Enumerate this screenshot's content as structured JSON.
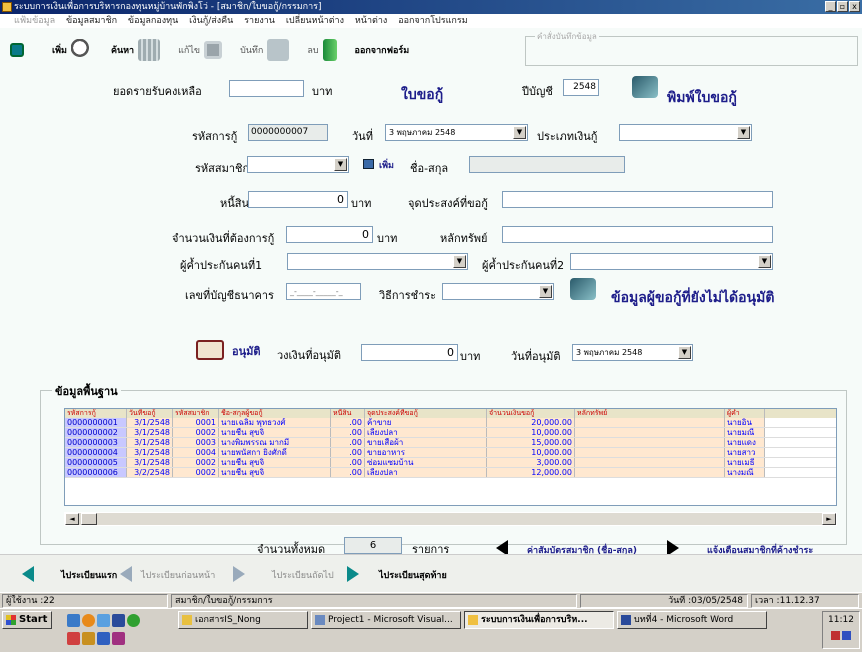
{
  "window": {
    "title": "ระบบการเงินเพื่อการบริหารกองทุนหมู่บ้านพักพิงโว่ - [สมาชิก/ใบขอกู้/กรรมการ]",
    "min": "_",
    "restore": "▫",
    "close": "x"
  },
  "menu": [
    "แฟ้มข้อมูล",
    "ข้อมูลสมาชิก",
    "ข้อมูลกองทุน",
    "เงินกู้/ส่งคืน",
    "รายงาน",
    "เปลี่ยนหน้าต่าง",
    "หน้าต่าง",
    "ออกจากโปรแกรม"
  ],
  "toolbar": {
    "add": "เพิ่ม",
    "search": "ค้นหา",
    "edit": "แก้ไข",
    "save": "บันทึก",
    "delete": "ลบ",
    "exit": "ออกจากฟอร์ม",
    "frame_label": "คำสั่งบันทึกข้อมูล"
  },
  "form": {
    "balance_label": "ยอดรายรับคงเหลือ",
    "balance_value": "",
    "baht": "บาท",
    "loan_slip_title": "ใบขอกู้",
    "fiscal_year_label": "ปีบัญชี",
    "fiscal_year": "2548",
    "print_label": "พิมพ์ใบขอกู้",
    "loan_code_label": "รหัสการกู้",
    "loan_code": "0000000007",
    "date_label": "วันที่",
    "date_value": "3 พฤษภาคม 2548",
    "loan_type_label": "ประเภทเงินกู้",
    "loan_type": "",
    "member_code_label": "รหัสสมาชิก",
    "member_code": "",
    "add_small": "เพิ่ม",
    "name_label": "ชื่อ-สกุล",
    "name_value": "",
    "debt_label": "หนี้สิน",
    "debt_value": "0",
    "purpose_label": "จุดประสงค์ที่ขอกู้",
    "purpose_value": "",
    "amount_label": "จำนวนเงินที่ต้องการกู้",
    "amount_value": "0",
    "collateral_label": "หลักทรัพย์",
    "collateral_value": "",
    "guarantor1_label": "ผู้ค้ำประกันคนที่1",
    "guarantor1": "",
    "guarantor2_label": "ผู้ค้ำประกันคนที่2",
    "guarantor2": "",
    "bank_account_label": "เลขที่บัญชีธนาคาร",
    "bank_account": "_-____-_____-_",
    "payment_method_label": "วิธีการชำระ",
    "payment_method": "",
    "unapproved_label": "ข้อมูลผู้ขอกู้ที่ยังไม่ได้อนุมัติ",
    "approve_label": "อนุมัติ",
    "approved_amount_label": "วงเงินที่อนุมัติ",
    "approved_amount": "0",
    "approve_date_label": "วันที่อนุมัติ",
    "approve_date": "3 พฤษภาคม 2548"
  },
  "basic": {
    "title": "ข้อมูลพื้นฐาน",
    "columns": [
      "รหัสการกู้",
      "วันที่ขอกู้",
      "รหัสสมาชิก",
      "ชื่อ-สกุลผู้ขอกู้",
      "หนี้สิน",
      "จุดประสงค์ที่ขอกู้",
      "จำนวนเงินขอกู้",
      "หลักทรัพย์",
      "ผู้ค้ำ"
    ],
    "rows": [
      [
        "0000000001",
        "3/1/2548",
        "0001",
        "นายเฉลิม พุทธวงศ์",
        ".00",
        "ค้าขาย",
        "20,000.00",
        "",
        "นายอิน"
      ],
      [
        "0000000002",
        "3/1/2548",
        "0002",
        "นายชื่น สุขจิ",
        ".00",
        "เลี้ยงปลา",
        "10,000.00",
        "",
        "นายมณี"
      ],
      [
        "0000000003",
        "3/1/2548",
        "0003",
        "นางพิมพรรณ มากมี",
        ".00",
        "ขายเสื้อผ้า",
        "15,000.00",
        "",
        "นายแดง"
      ],
      [
        "0000000004",
        "3/1/2548",
        "0004",
        "นายพนัสกา ยิ่งศักดิ์",
        ".00",
        "ขายอาหาร",
        "10,000.00",
        "",
        "นายสาว"
      ],
      [
        "0000000005",
        "3/1/2548",
        "0002",
        "นายชื่น สุขจิ",
        ".00",
        "ซ่อมแซมบ้าน",
        "3,000.00",
        "",
        "นายเมธี"
      ],
      [
        "0000000006",
        "3/2/2548",
        "0002",
        "นายชื่น สุขจิ",
        ".00",
        "เลี้ยงปลา",
        "12,000.00",
        "",
        "นางมณี"
      ]
    ],
    "total_label": "จำนวนทั้งหมด",
    "total_value": "6",
    "unit": "รายการ",
    "link_left": "ค่าสัมบัตรสมาชิก (ชื่อ-สกุล)",
    "link_right": "แจ้งเตือนสมาชิกที่ค้างชำระ"
  },
  "nav": {
    "first": "ไประเบียนแรก",
    "prev": "ไประเบียนก่อนหน้า",
    "next": "ไประเบียนถัดไป",
    "last": "ไประเบียนสุดท้าย"
  },
  "status": {
    "user": "ผู้ใช้งาน :22",
    "form": "สมาชิก/ใบขอกู้/กรรมการ",
    "date": "วันที่ :03/05/2548",
    "time": "เวลา :11.12.37"
  },
  "taskbar": {
    "start": "Start",
    "tasks": [
      "เอกสารIS_Nong",
      "Project1 - Microsoft Visual...",
      "ระบบการเงินเพื่อการบริห...",
      "บทที่4 - Microsoft Word"
    ],
    "clock": "11:12"
  }
}
